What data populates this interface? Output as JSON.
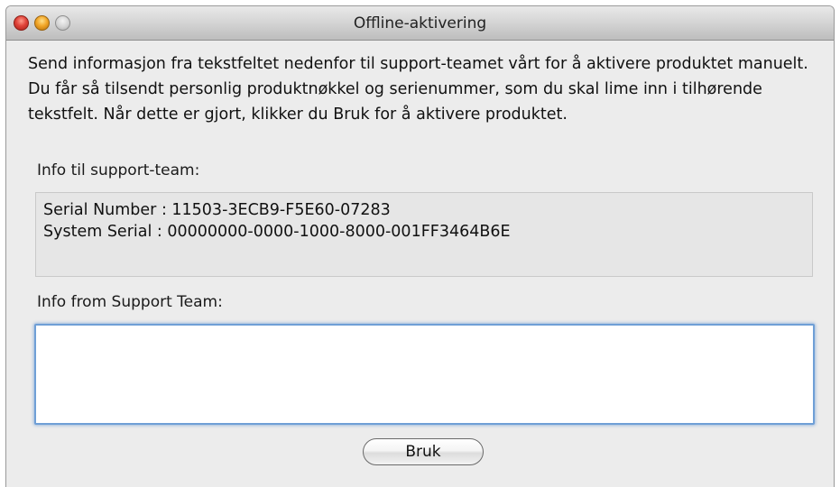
{
  "window": {
    "title": "Offline-aktivering"
  },
  "description": "Send informasjon fra tekstfeltet nedenfor til support-teamet vårt for å aktivere produktet manuelt. Du får så tilsendt personlig produktnøkkel og serienummer, som du skal lime inn i tilhørende tekstfelt. Når dette er gjort, klikker du Bruk for å aktivere produktet.",
  "info_to_support": {
    "label": "Info til support-team:",
    "lines": [
      "Serial Number : 11503-3ECB9-F5E60-07283",
      "System Serial : 00000000-0000-1000-8000-001FF3464B6E"
    ]
  },
  "info_from_support": {
    "label": "Info from Support Team:",
    "value": ""
  },
  "buttons": {
    "apply_label": "Bruk"
  },
  "colors": {
    "focus_ring": "#6f9fd6",
    "window_bg": "#ececec",
    "close": "#e0443a",
    "minimize": "#f2a729",
    "zoom": "#d3d3d3"
  },
  "icons": [
    "close-button",
    "minimize-button",
    "zoom-button"
  ]
}
